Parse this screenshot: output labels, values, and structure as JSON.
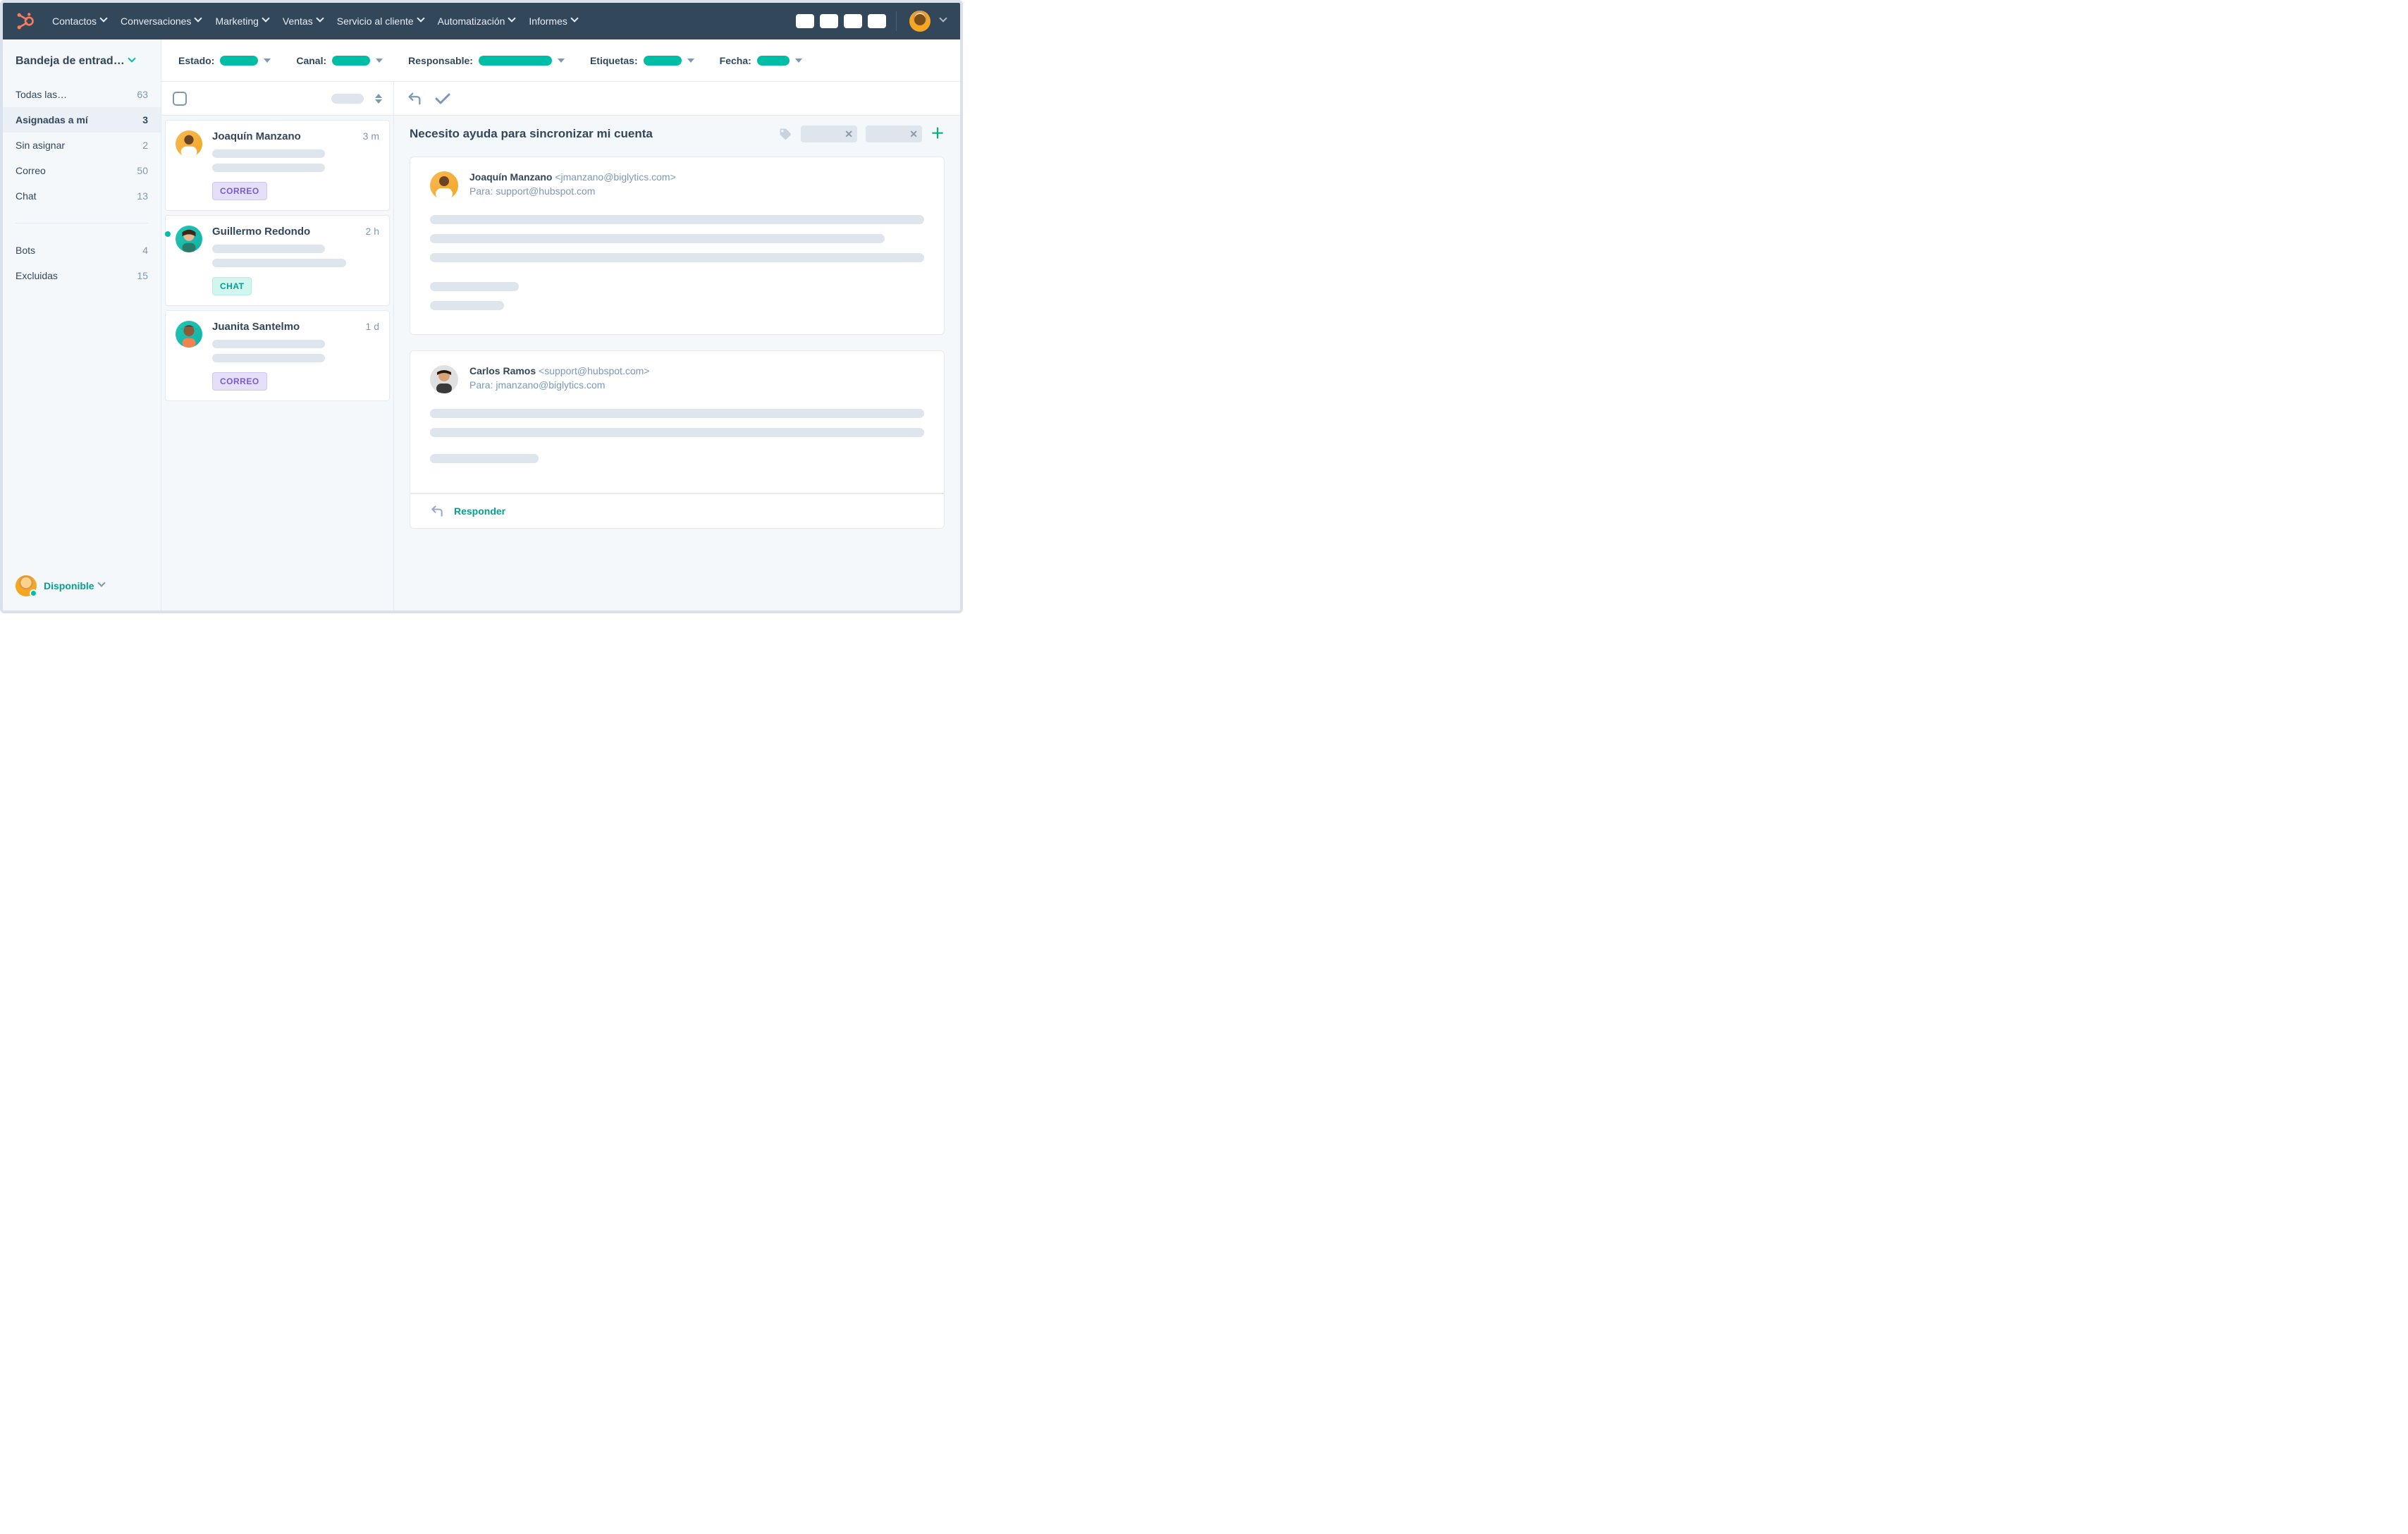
{
  "nav": {
    "items": [
      "Contactos",
      "Conversaciones",
      "Marketing",
      "Ventas",
      "Servicio al cliente",
      "Automatización",
      "Informes"
    ]
  },
  "sidebar": {
    "title": "Bandeja de entrad…",
    "views": [
      {
        "label": "Todas las…",
        "count": "63"
      },
      {
        "label": "Asignadas a mí",
        "count": "3"
      },
      {
        "label": "Sin asignar",
        "count": "2"
      },
      {
        "label": "Correo",
        "count": "50"
      },
      {
        "label": "Chat",
        "count": "13"
      }
    ],
    "secondary": [
      {
        "label": "Bots",
        "count": "4"
      },
      {
        "label": "Excluidas",
        "count": "15"
      }
    ],
    "status": "Disponible"
  },
  "filters": {
    "estado_label": "Estado:",
    "canal_label": "Canal:",
    "responsable_label": "Responsable:",
    "etiquetas_label": "Etiquetas:",
    "fecha_label": "Fecha:"
  },
  "conversations": [
    {
      "name": "Joaquín Manzano",
      "time": "3 m",
      "badge": "CORREO"
    },
    {
      "name": "Guillermo Redondo",
      "time": "2 h",
      "badge": "CHAT"
    },
    {
      "name": "Juanita Santelmo",
      "time": "1 d",
      "badge": "CORREO"
    }
  ],
  "thread": {
    "subject": "Necesito ayuda para sincronizar mi cuenta",
    "messages": [
      {
        "from_name": "Joaquín Manzano",
        "from_email": "<jmanzano@biglytics.com>",
        "to_label": "Para: support@hubspot.com"
      },
      {
        "from_name": "Carlos Ramos",
        "from_email": "<support@hubspot.com>",
        "to_label": "Para: jmanzano@biglytics.com"
      }
    ],
    "reply_label": "Responder"
  }
}
